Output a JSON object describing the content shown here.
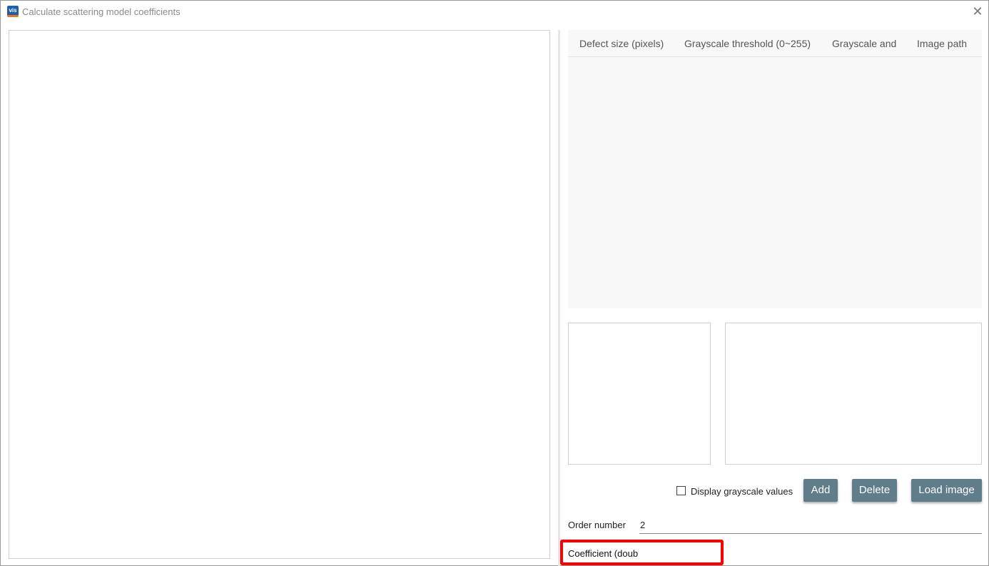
{
  "window": {
    "title": "Calculate scattering model coefficients",
    "app_icon_text": "vis",
    "close_glyph": "✕"
  },
  "table": {
    "columns": [
      "Defect size (pixels)",
      "Grayscale threshold (0~255)",
      "Grayscale and",
      "Image path"
    ]
  },
  "options": {
    "display_grayscale_label": "Display grayscale values",
    "display_grayscale_checked": false
  },
  "buttons": {
    "add": "Add",
    "delete": "Delete",
    "load_image": "Load image"
  },
  "order": {
    "label": "Order number",
    "value": "2"
  },
  "coefficient": {
    "label": "Coefficient (doub"
  },
  "colors": {
    "button_bg": "#607d8b",
    "highlight": "#ff0000",
    "grid_bg": "#f8f8f8"
  }
}
